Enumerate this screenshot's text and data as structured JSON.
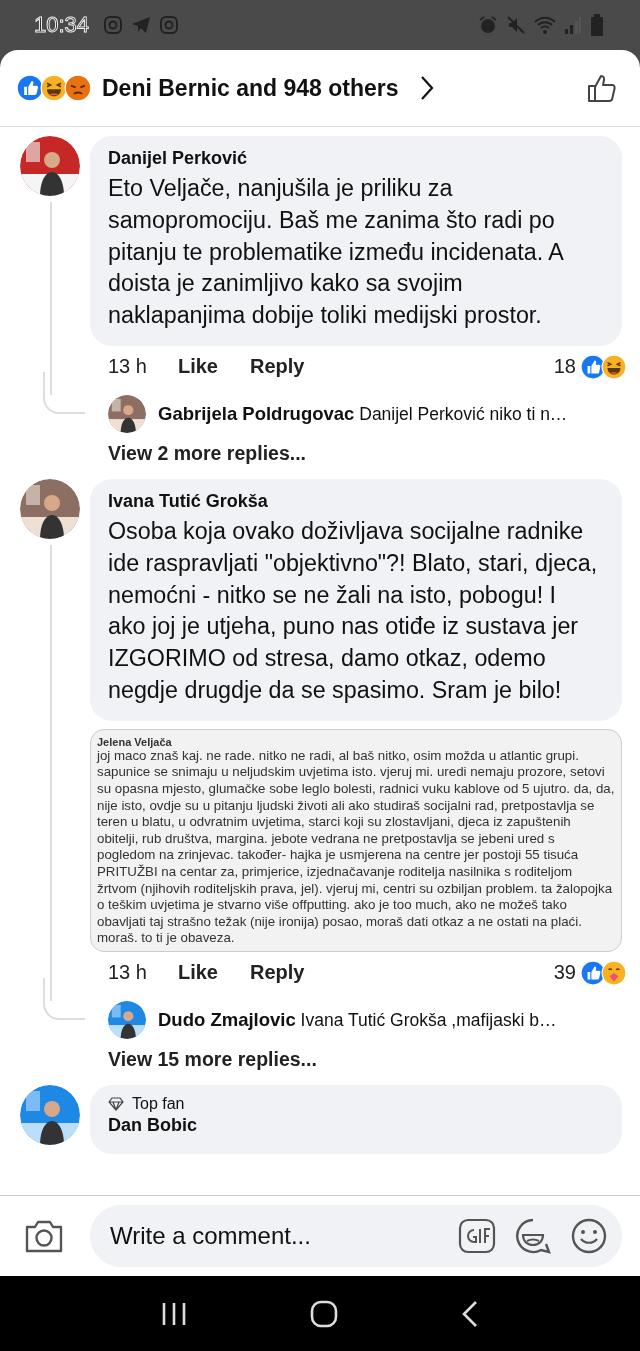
{
  "status_bar": {
    "time": "10:34"
  },
  "header": {
    "reactions": [
      {
        "kind": "like"
      },
      {
        "kind": "haha"
      },
      {
        "kind": "angry"
      }
    ],
    "title": "Deni Bernic and 948 others"
  },
  "comments": [
    {
      "author": "Danijel Perković",
      "text": "Eto Veljače, nanjušila je priliku za samopromociju. Baš me zanima što radi po pitanju te problematike između incidenata. A doista je zanimljivo kako sa svojim naklapanjima dobije toliki medijski prostor.",
      "time": "13 h",
      "like": "Like",
      "reply": "Reply",
      "reaction_count": "18",
      "reactions": [
        {
          "kind": "like"
        },
        {
          "kind": "haha"
        }
      ],
      "reply_preview": {
        "author": "Gabrijela Poldrugovac",
        "text": "Danijel Perković niko ti n…"
      },
      "more_replies": "View 2 more replies..."
    },
    {
      "author": "Ivana Tutić Grokša",
      "text": "Osoba koja ovako doživljava socijalne radnike ide raspravljati \"objektivno\"?! Blato, stari, djeca, nemoćni - nitko se ne žali na isto, pobogu! I ako joj je utjeha, puno nas otiđe iz sustava jer IZGORIMO od stresa, damo otkaz, odemo negdje drugdje da se spasimo. Sram je bilo!",
      "attachment": {
        "author": "Jelena Veljača",
        "text": "joj maco znaš kaj. ne rade. nitko ne radi, al baš nitko, osim možda u atlantic grupi. sapunice se snimaju u neljudskim uvjetima isto. vjeruj mi. uredi nemaju prozore, setovi su opasna mjesto, glumačke sobe leglo bolesti, radnici vuku kablove od 5 ujutro. da, da, nije isto, ovdje su u pitanju ljudski životi ali ako studiraš socijalni rad, pretpostavlja se teren u blatu, u odvratnim uvjetima, starci koji su zlostavljani, djeca iz zapuštenih obitelji, rub društva, margina. jebote vedrana ne pretpostavlja se jebeni ured s pogledom na zrinjevac. također- hajka je usmjerena na centre jer postoji 55 tisuća PRITUŽBI na centar za, primjerice, izjednačavanje roditelja nasilnika s roditeljom žrtvom (njihovih roditeljskih prava, jel). vjeruj mi, centri su ozbiljan problem. ta žalopojka o teškim uvjetima je stvarno više offputting. ako je too much, ako ne možeš tako obavljati taj strašno težak (nije ironija) posao, moraš dati otkaz a ne ostati na plaći. moraš. to ti je obaveza."
      },
      "time": "13 h",
      "like": "Like",
      "reply": "Reply",
      "reaction_count": "39",
      "reactions": [
        {
          "kind": "like"
        },
        {
          "kind": "care"
        }
      ],
      "reply_preview": {
        "author": "Dudo Zmajlovic",
        "text": "Ivana Tutić Grokša ,mafijaski b…"
      },
      "more_replies": "View 15 more replies..."
    },
    {
      "badge": "Top fan",
      "author": "Dan Bobic"
    }
  ],
  "composer": {
    "placeholder": "Write a comment..."
  }
}
